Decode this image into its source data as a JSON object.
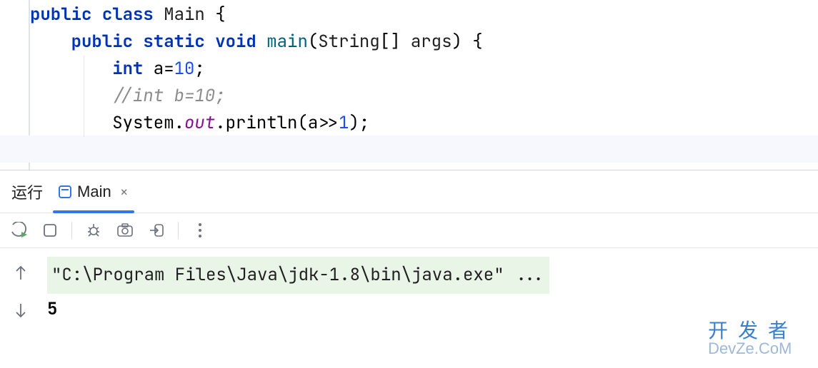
{
  "code": {
    "line1": {
      "kw1": "public",
      "kw2": "class",
      "name": "Main",
      "brace": " {"
    },
    "line2": {
      "kw1": "public",
      "kw2": "static",
      "kw3": "void",
      "name": "main",
      "params_open": "(",
      "type": "String",
      "brackets": "[] ",
      "arg": "args",
      "params_close": ") {"
    },
    "line3": {
      "type": "int",
      "rest": " a=",
      "num": "10",
      "semi": ";"
    },
    "line4": {
      "comment": "//int b=10;"
    },
    "line5": {
      "cls": "System.",
      "field": "out",
      "call1": ".println(a>>",
      "num": "1",
      "call2": ");"
    }
  },
  "panel": {
    "run_label": "运行",
    "tab_label": "Main"
  },
  "console": {
    "command": "\"C:\\Program Files\\Java\\jdk-1.8\\bin\\java.exe\" ...",
    "output": "5"
  },
  "watermark": {
    "cn": "开发者",
    "en": "DevZe.CoM"
  }
}
